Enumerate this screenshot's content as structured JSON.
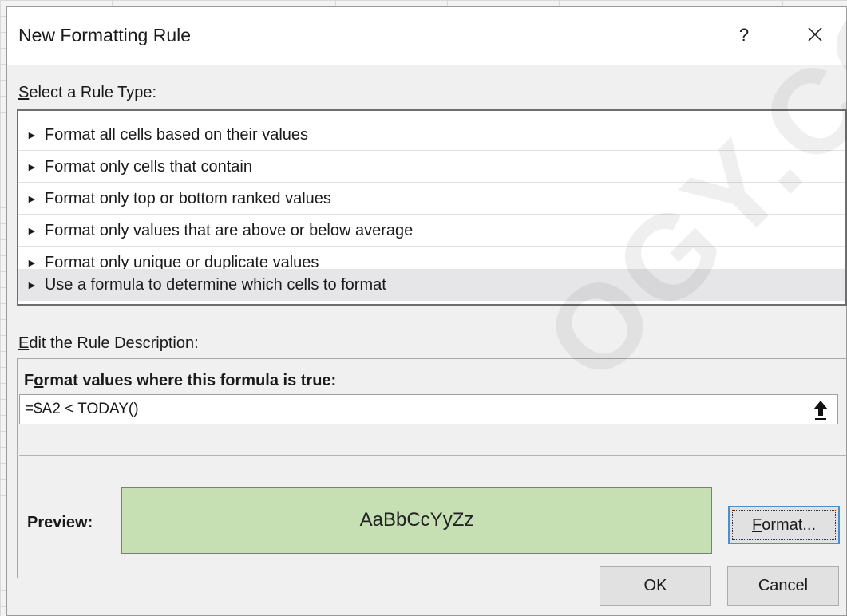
{
  "dialog": {
    "title": "New Formatting Rule",
    "help_label": "?",
    "close_icon": "close-icon"
  },
  "rule_type": {
    "label_accel": "S",
    "label_rest": "elect a Rule Type:",
    "items": [
      {
        "label": "Format all cells based on their values",
        "selected": false
      },
      {
        "label": "Format only cells that contain",
        "selected": false
      },
      {
        "label": "Format only top or bottom ranked values",
        "selected": false
      },
      {
        "label": "Format only values that are above or below average",
        "selected": false
      },
      {
        "label": "Format only unique or duplicate values",
        "selected": false
      },
      {
        "label": "Use a formula to determine which cells to format",
        "selected": true
      }
    ],
    "arrow_glyph": "►"
  },
  "description": {
    "label_accel": "E",
    "label_rest": "dit the Rule Description:",
    "heading_pre": "F",
    "heading_accel": "o",
    "heading_rest": "rmat values where this formula is true:",
    "formula_value": "=$A2 < TODAY()",
    "collapse_icon": "collapse-dialog-icon"
  },
  "preview": {
    "label": "Preview:",
    "sample_text": "AaBbCcYyZz",
    "fill_color": "#c6e0b4"
  },
  "buttons": {
    "format_accel": "F",
    "format_rest": "ormat...",
    "ok": "OK",
    "cancel": "Cancel"
  },
  "watermark": {
    "text": "OGY.CO"
  }
}
